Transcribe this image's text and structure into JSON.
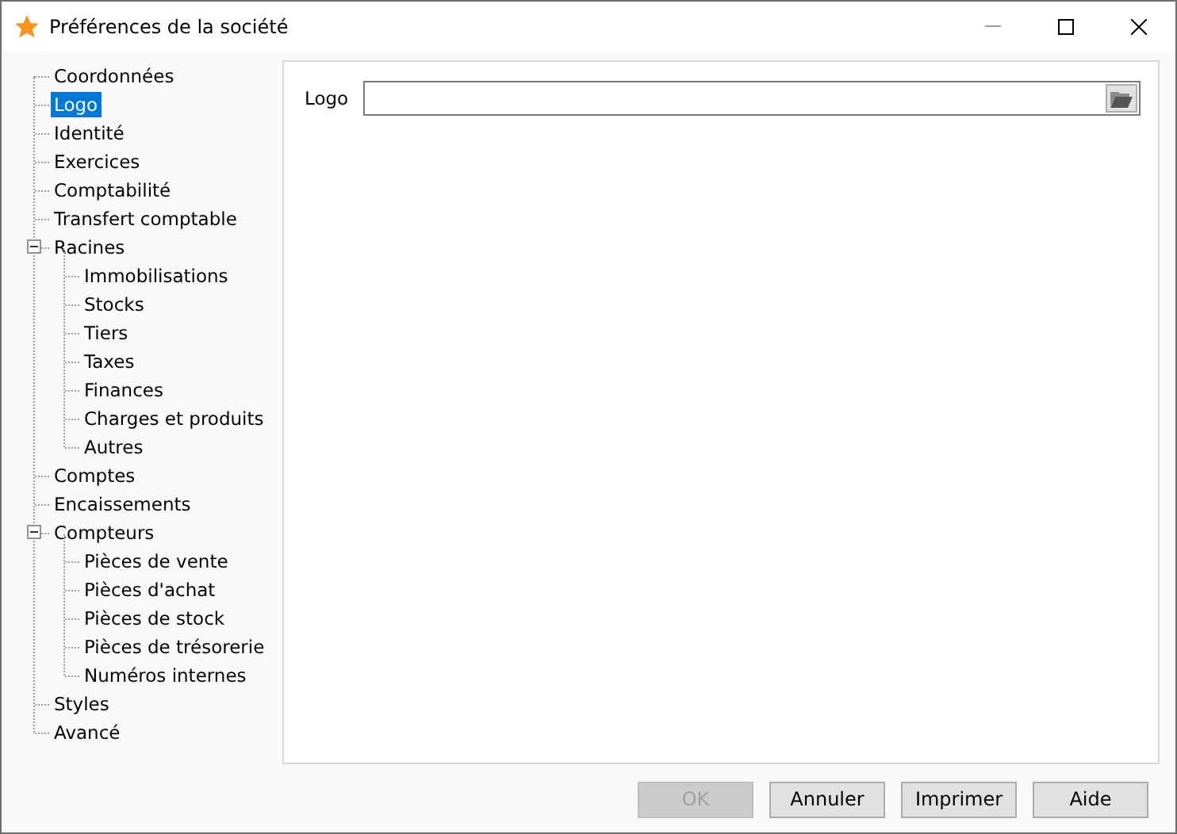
{
  "window": {
    "title": "Préférences de la société"
  },
  "tree": [
    {
      "label": "Coordonnées",
      "selected": false
    },
    {
      "label": "Logo",
      "selected": true
    },
    {
      "label": "Identité",
      "selected": false
    },
    {
      "label": "Exercices",
      "selected": false
    },
    {
      "label": "Comptabilité",
      "selected": false
    },
    {
      "label": "Transfert comptable",
      "selected": false
    },
    {
      "label": "Racines",
      "selected": false,
      "expanded": true,
      "children": [
        {
          "label": "Immobilisations",
          "selected": false
        },
        {
          "label": "Stocks",
          "selected": false
        },
        {
          "label": "Tiers",
          "selected": false
        },
        {
          "label": "Taxes",
          "selected": false
        },
        {
          "label": "Finances",
          "selected": false
        },
        {
          "label": "Charges et produits",
          "selected": false
        },
        {
          "label": "Autres",
          "selected": false
        }
      ]
    },
    {
      "label": "Comptes",
      "selected": false
    },
    {
      "label": "Encaissements",
      "selected": false
    },
    {
      "label": "Compteurs",
      "selected": false,
      "expanded": true,
      "children": [
        {
          "label": "Pièces de vente",
          "selected": false
        },
        {
          "label": "Pièces d'achat",
          "selected": false
        },
        {
          "label": "Pièces de stock",
          "selected": false
        },
        {
          "label": "Pièces de trésorerie",
          "selected": false
        },
        {
          "label": "Numéros internes",
          "selected": false
        }
      ]
    },
    {
      "label": "Styles",
      "selected": false
    },
    {
      "label": "Avancé",
      "selected": false
    }
  ],
  "logo_field": {
    "label": "Logo"
  },
  "buttons": [
    {
      "label": "OK",
      "disabled": true
    },
    {
      "label": "Annuler",
      "disabled": false
    },
    {
      "label": "Imprimer",
      "disabled": false
    },
    {
      "label": "Aide",
      "disabled": false
    }
  ]
}
